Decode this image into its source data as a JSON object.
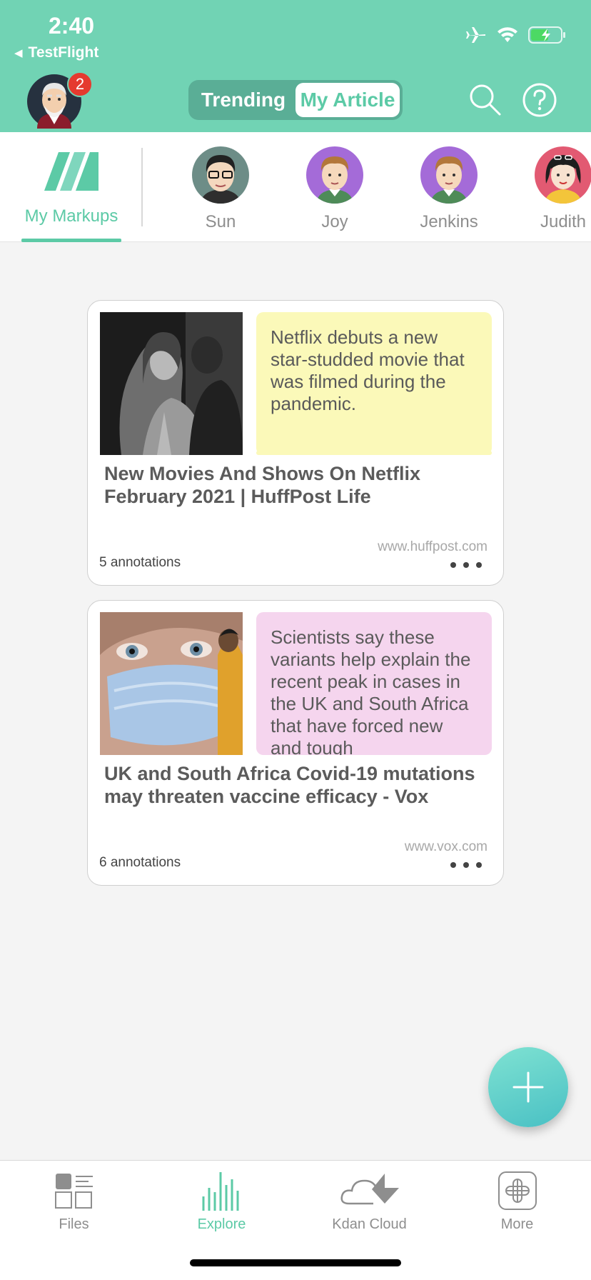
{
  "status": {
    "time": "2:40",
    "back_app": "TestFlight"
  },
  "header": {
    "badge_count": "2",
    "tabs": [
      {
        "label": "Trending",
        "active": false
      },
      {
        "label": "My Article",
        "active": true
      }
    ],
    "search_icon": "search-icon",
    "help_icon": "help-icon"
  },
  "filter": {
    "my_markups": "My Markups",
    "people": [
      {
        "name": "Sun"
      },
      {
        "name": "Joy"
      },
      {
        "name": "Jenkins"
      },
      {
        "name": "Judith"
      }
    ]
  },
  "cards": [
    {
      "note": "Netflix debuts a new star-studded movie that was filmed during the pandemic.",
      "title": "New Movies And Shows On Netflix February 2021 | HuffPost Life",
      "domain": "www.huffpost.com",
      "annotations": "5 annotations",
      "note_color": "#fbf9b9"
    },
    {
      "note": "Scientists say these variants help explain the recent peak in cases in the UK and South Africa that have forced new and tough",
      "title": "UK and South Africa Covid-19 mutations may threaten vaccine efficacy - Vox",
      "domain": "www.vox.com",
      "annotations": "6 annotations",
      "note_color": "#f5d5ee"
    }
  ],
  "tabbar": {
    "items": [
      {
        "label": "Files"
      },
      {
        "label": "Explore",
        "active": true
      },
      {
        "label": "Kdan Cloud"
      },
      {
        "label": "More"
      }
    ]
  },
  "colors": {
    "header_bg": "#71d3b4",
    "accent": "#5ccaa6",
    "badge": "#e53a2f"
  }
}
